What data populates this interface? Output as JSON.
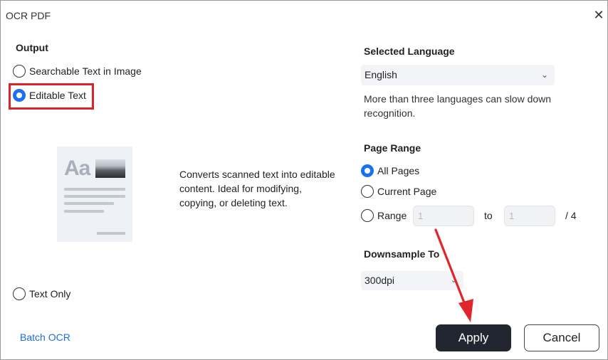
{
  "window": {
    "title": "OCR PDF",
    "close_icon": "close-icon"
  },
  "output": {
    "heading": "Output",
    "options": [
      {
        "label": "Searchable Text in Image",
        "checked": false
      },
      {
        "label": "Editable Text",
        "checked": true
      },
      {
        "label": "Text Only",
        "checked": false
      }
    ],
    "preview_sample_text": "Aa",
    "description": "Converts scanned text into editable content. Ideal for modifying, copying, or deleting text."
  },
  "language": {
    "heading": "Selected Language",
    "selected": "English",
    "note": "More than three languages can slow down recognition."
  },
  "page_range": {
    "heading": "Page Range",
    "options": [
      {
        "label": "All Pages",
        "checked": true
      },
      {
        "label": "Current Page",
        "checked": false
      },
      {
        "label": "Range",
        "checked": false
      }
    ],
    "from_placeholder": "1",
    "to_label": "to",
    "to_placeholder": "1",
    "total": "/ 4"
  },
  "downsample": {
    "heading": "Downsample To",
    "selected": "300dpi"
  },
  "footer": {
    "batch_link": "Batch OCR",
    "apply_label": "Apply",
    "cancel_label": "Cancel"
  },
  "colors": {
    "accent": "#1a6ff2",
    "primary_button": "#222631",
    "annotation_red": "#d9252a",
    "link": "#1a6ed8"
  }
}
